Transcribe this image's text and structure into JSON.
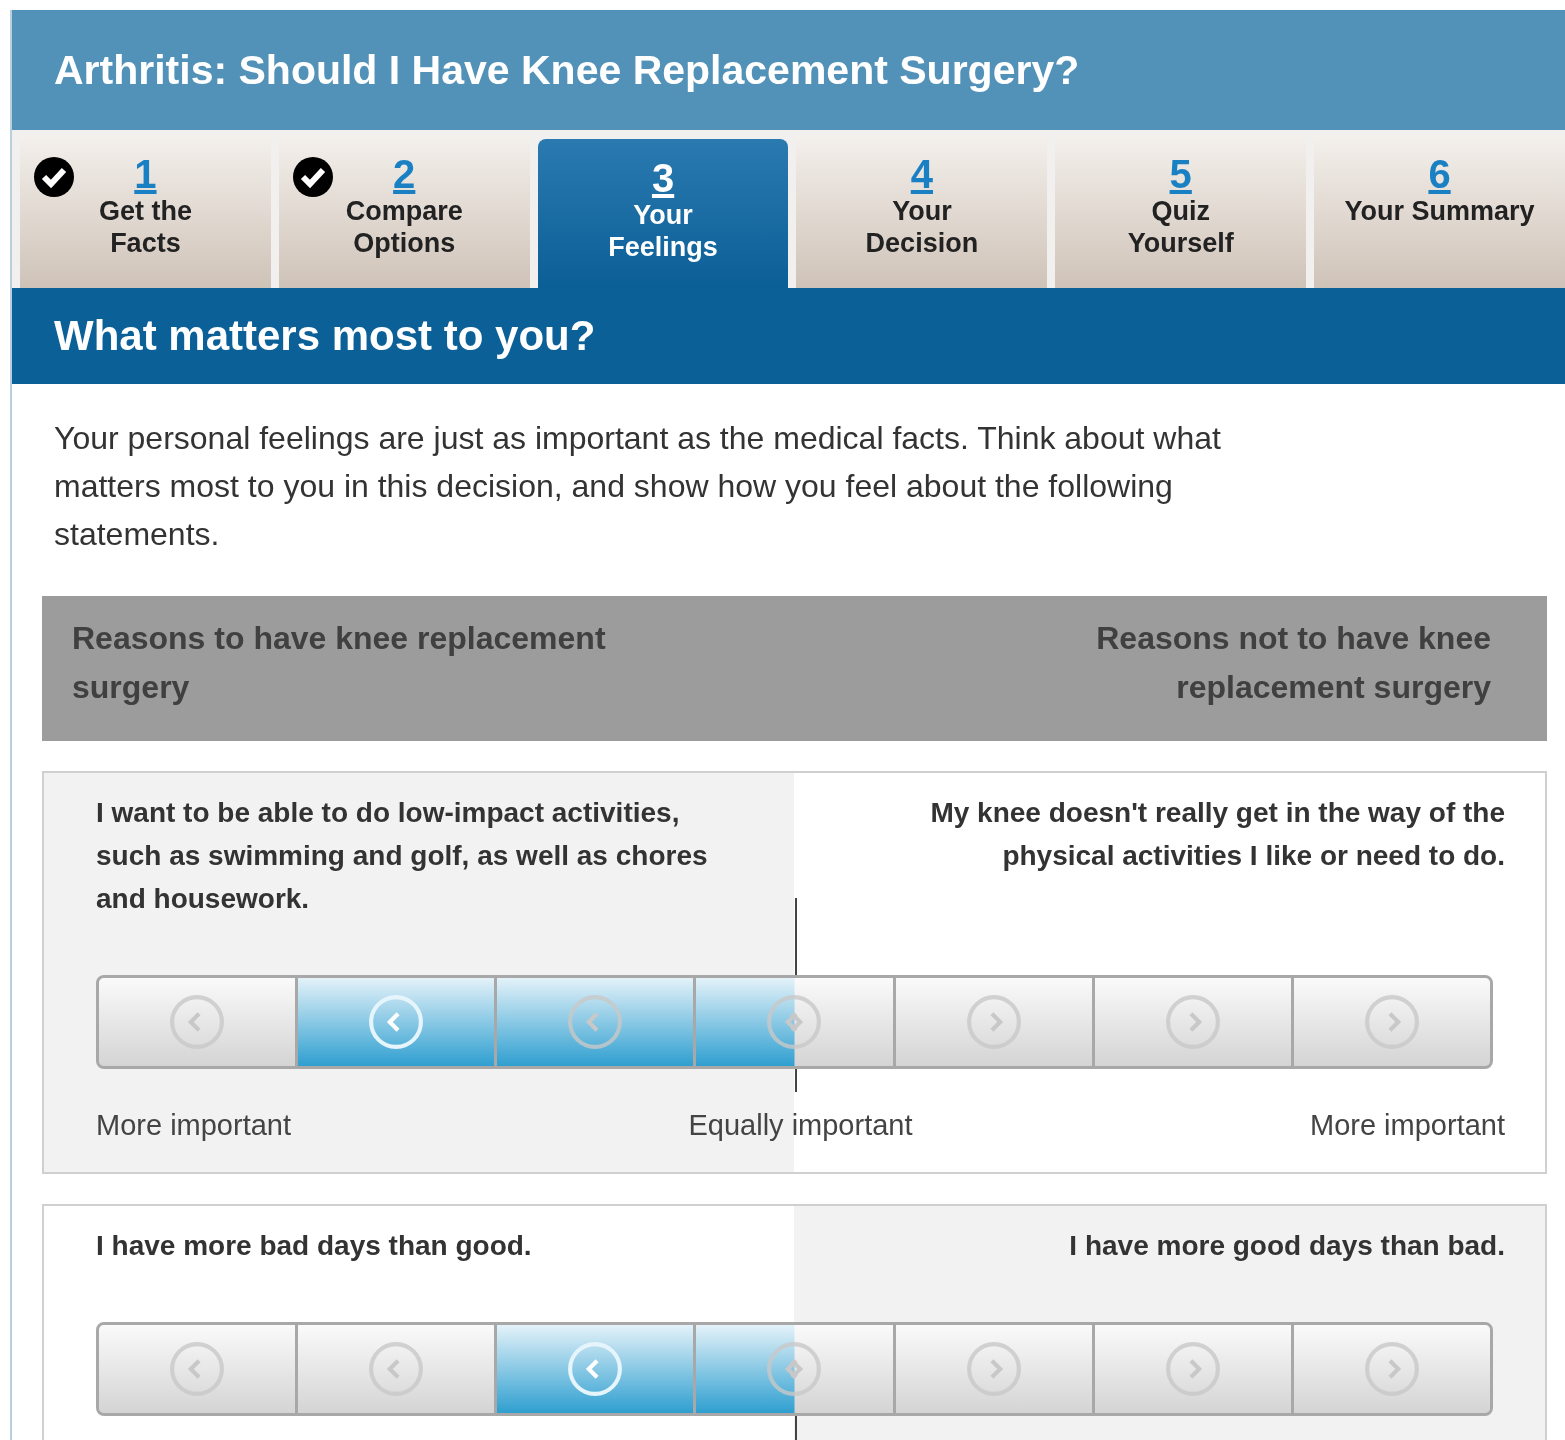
{
  "title": "Arthritis: Should I Have Knee Replacement Surgery?",
  "tabs": [
    {
      "number": "1",
      "label": "Get the Facts",
      "done": true,
      "selected": false
    },
    {
      "number": "2",
      "label": "Compare Options",
      "done": true,
      "selected": false
    },
    {
      "number": "3",
      "label": "Your Feelings",
      "done": false,
      "selected": true
    },
    {
      "number": "4",
      "label": "Your Decision",
      "done": false,
      "selected": false
    },
    {
      "number": "5",
      "label": "Quiz Yourself",
      "done": false,
      "selected": false
    },
    {
      "number": "6",
      "label": "Your Summary",
      "done": false,
      "selected": false
    }
  ],
  "section_heading": "What matters most to you?",
  "intro": "Your personal feelings are just as important as the medical facts. Think about what matters most to you in this decision, and show how you feel about the following statements.",
  "columns": {
    "left": "Reasons to have knee replacement surgery",
    "right": "Reasons not to have knee replacement surgery"
  },
  "statements": [
    {
      "left": "I want to be able to do low-impact activities, such as swimming and golf, as well as chores and housework.",
      "right": "My knee doesn't really get in the way of the physical activities I like or need to do.",
      "left_shaded": true,
      "positions": [
        {
          "selected": false,
          "filled": false
        },
        {
          "selected": true,
          "filled": true
        },
        {
          "selected": false,
          "filled": true
        },
        {
          "selected": false,
          "filled": true
        },
        {
          "selected": false,
          "filled": false
        },
        {
          "selected": false,
          "filled": false
        },
        {
          "selected": false,
          "filled": false
        }
      ],
      "scale": [
        "More important",
        "Equally important",
        "More important"
      ]
    },
    {
      "left": "I have more bad days than good.",
      "right": "I have more good days than bad.",
      "left_shaded": false,
      "positions": [
        {
          "selected": false,
          "filled": false
        },
        {
          "selected": false,
          "filled": false
        },
        {
          "selected": true,
          "filled": true
        },
        {
          "selected": false,
          "filled": true
        },
        {
          "selected": false,
          "filled": false
        },
        {
          "selected": false,
          "filled": false
        },
        {
          "selected": false,
          "filled": false
        }
      ]
    }
  ]
}
